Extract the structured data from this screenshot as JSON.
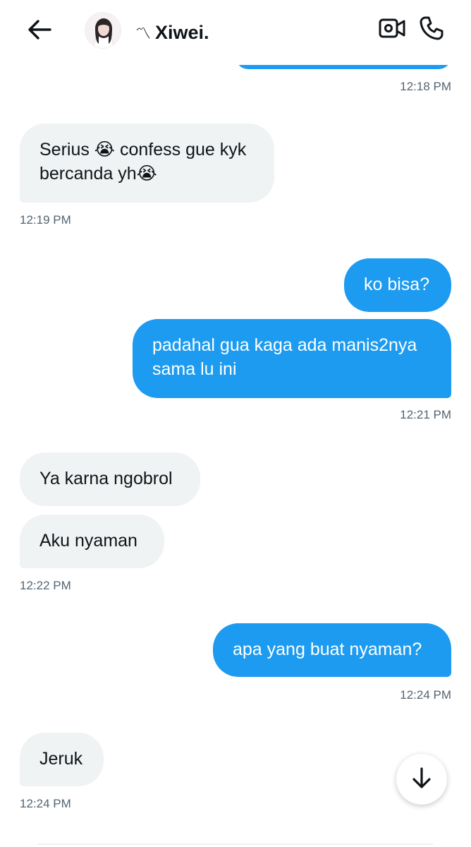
{
  "header": {
    "contact_name": "Xiwei.",
    "name_decoration": "〽︎",
    "icons": {
      "back": "arrow-left-icon",
      "video": "video-camera-icon",
      "call": "phone-icon",
      "scroll": "arrow-down-icon"
    }
  },
  "messages": [
    {
      "from": "me",
      "text": "",
      "time": "12:18 PM"
    },
    {
      "from": "them",
      "line1": "Serius 😭 confess gue kyk",
      "line2": "bercanda yh😭",
      "time": "12:19 PM"
    },
    {
      "from": "me",
      "text": "ko bisa?"
    },
    {
      "from": "me",
      "line1": "padahal gua kaga ada manis2nya",
      "line2": "sama lu ini",
      "time": "12:21 PM"
    },
    {
      "from": "them",
      "text": "Ya karna ngobrol"
    },
    {
      "from": "them",
      "text": "Aku nyaman",
      "time": "12:22 PM"
    },
    {
      "from": "me",
      "text": "apa yang buat nyaman?",
      "time": "12:24 PM"
    },
    {
      "from": "them",
      "text": "Jeruk",
      "time": "12:24 PM"
    }
  ],
  "colors": {
    "outgoing_bubble": "#1d9bf0",
    "incoming_bubble": "#eff3f4",
    "timestamp": "#536471",
    "text": "#0f1419"
  }
}
